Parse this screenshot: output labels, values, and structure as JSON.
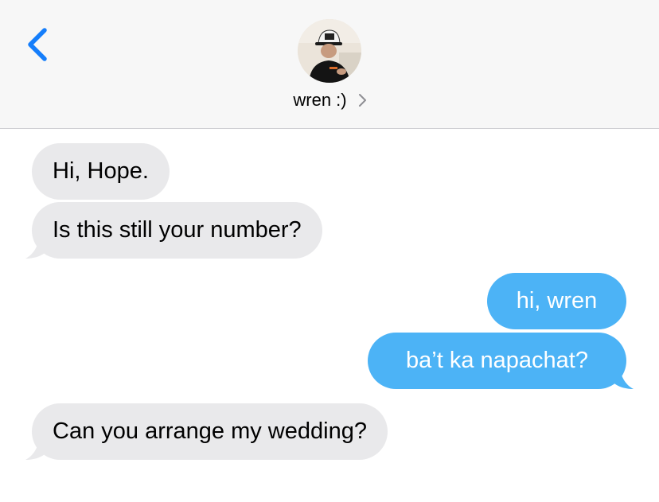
{
  "header": {
    "back_icon": "chevron-left-icon",
    "contact_name": "wren :)",
    "contact_chevron_icon": "chevron-right-icon",
    "avatar": "contact-photo"
  },
  "messages": [
    {
      "direction": "incoming",
      "text": "Hi, Hope."
    },
    {
      "direction": "incoming",
      "text": "Is this still your number?"
    },
    {
      "direction": "outgoing",
      "text": "hi, wren"
    },
    {
      "direction": "outgoing",
      "text": "ba’t ka napachat?"
    },
    {
      "direction": "incoming",
      "text": "Can you arrange my wedding?"
    }
  ],
  "colors": {
    "accent": "#157efb",
    "incoming_bubble": "#e9e9eb",
    "outgoing_bubble": "#4cb3f6",
    "header_bg": "#f7f7f7"
  }
}
